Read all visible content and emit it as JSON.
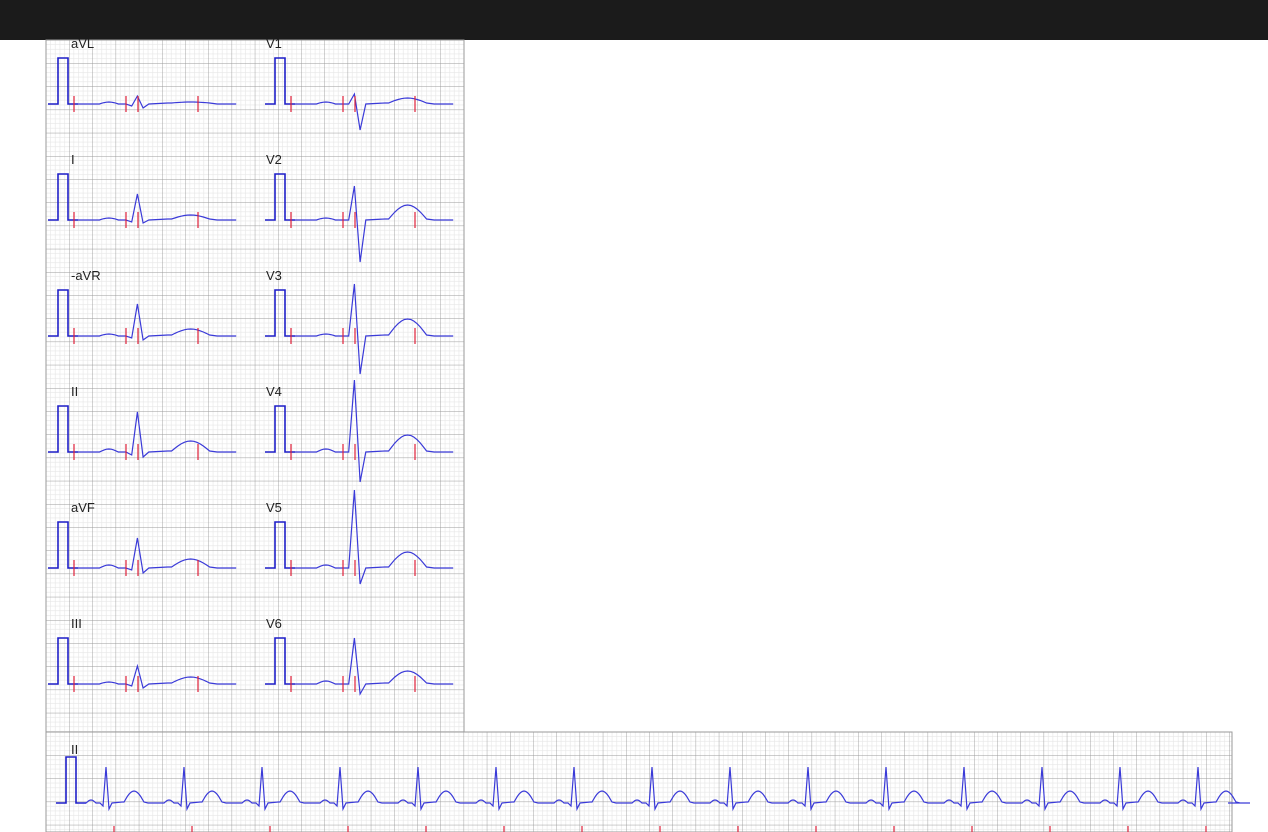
{
  "window": {
    "title_bar_color": "#1b1b1b"
  },
  "colors": {
    "grid_minor": "#e6e6e6",
    "grid_major": "#9a9a9a",
    "trace": "#3a3ad8",
    "calibration": "#1f1fc8",
    "marker": "#e0203a",
    "background": "#ffffff"
  },
  "leads_left_column": [
    "aVL",
    "I",
    "-aVR",
    "II",
    "aVF",
    "III"
  ],
  "leads_right_column": [
    "V1",
    "V2",
    "V3",
    "V4",
    "V5",
    "V6"
  ],
  "rhythm_strip": {
    "label": "II",
    "beat_count": 15
  }
}
